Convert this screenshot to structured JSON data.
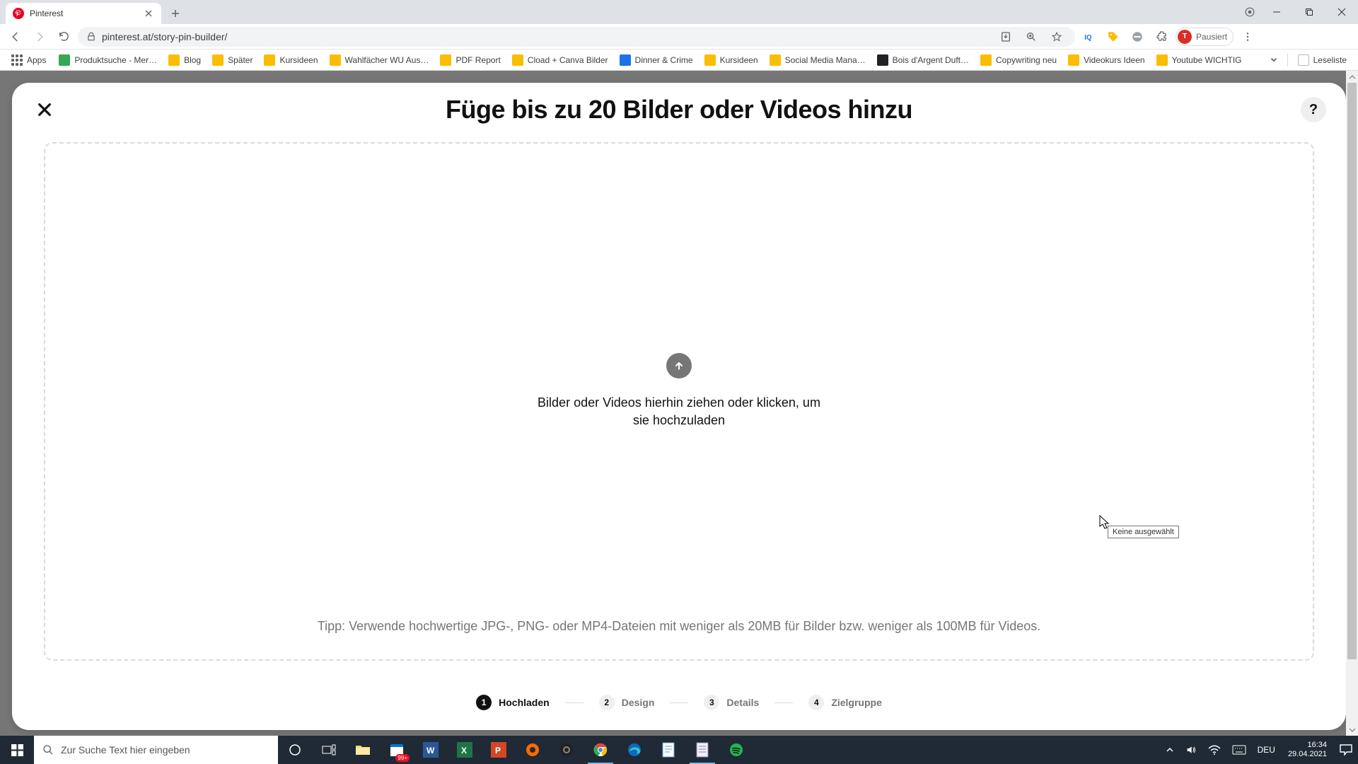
{
  "browser": {
    "tab_title": "Pinterest",
    "url_display": "pinterest.at/story-pin-builder/",
    "profile_status": "Pausiert",
    "profile_initial": "T",
    "apps_label": "Apps"
  },
  "bookmarks": [
    {
      "label": "Produktsuche - Mer…",
      "kind": "green"
    },
    {
      "label": "Blog",
      "kind": "y"
    },
    {
      "label": "Später",
      "kind": "y"
    },
    {
      "label": "Kursideen",
      "kind": "y"
    },
    {
      "label": "Wahlfächer WU Aus…",
      "kind": "y"
    },
    {
      "label": "PDF Report",
      "kind": "y"
    },
    {
      "label": "Cload + Canva Bilder",
      "kind": "y"
    },
    {
      "label": "Dinner & Crime",
      "kind": "blue"
    },
    {
      "label": "Kursideen",
      "kind": "y"
    },
    {
      "label": "Social Media Mana…",
      "kind": "y"
    },
    {
      "label": "Bois d'Argent Duft…",
      "kind": "dark"
    },
    {
      "label": "Copywriting neu",
      "kind": "y"
    },
    {
      "label": "Videokurs Ideen",
      "kind": "y"
    },
    {
      "label": "Youtube WICHTIG",
      "kind": "y"
    }
  ],
  "bookmarks_right": {
    "label": "Leseliste"
  },
  "modal": {
    "title": "Füge bis zu 20 Bilder oder Videos hinzu",
    "drop_text": "Bilder oder Videos hierhin ziehen oder klicken, um sie hochzuladen",
    "tip_text": "Tipp: Verwende hochwertige JPG-, PNG- oder MP4-Dateien mit weniger als 20MB für Bilder bzw. weniger als 100MB für Videos.",
    "help_text": "?",
    "tooltip": "Keine ausgewählt"
  },
  "steps": [
    {
      "num": "1",
      "label": "Hochladen",
      "active": true
    },
    {
      "num": "2",
      "label": "Design",
      "active": false
    },
    {
      "num": "3",
      "label": "Details",
      "active": false
    },
    {
      "num": "4",
      "label": "Zielgruppe",
      "active": false
    }
  ],
  "taskbar": {
    "search_placeholder": "Zur Suche Text hier eingeben",
    "badge": "99+",
    "lang": "DEU",
    "time": "16:34",
    "date": "29.04.2021"
  }
}
